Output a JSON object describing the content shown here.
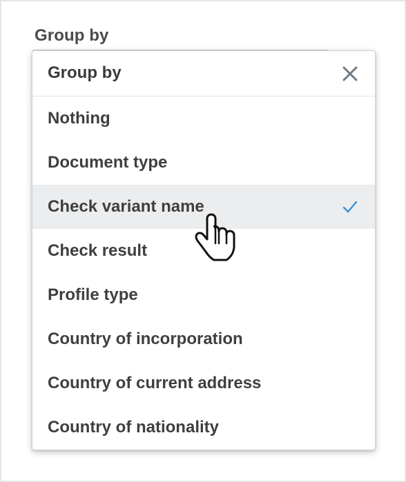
{
  "field": {
    "label": "Group by"
  },
  "dropdown": {
    "title": "Group by",
    "close_icon": "close-icon",
    "selected_index": 2,
    "options": [
      {
        "label": "Nothing"
      },
      {
        "label": "Document type"
      },
      {
        "label": "Check variant name"
      },
      {
        "label": "Check result"
      },
      {
        "label": "Profile type"
      },
      {
        "label": "Country of incorporation"
      },
      {
        "label": "Country of current address"
      },
      {
        "label": "Country of nationality"
      }
    ]
  },
  "colors": {
    "accent_check": "#3a8fd6",
    "selected_row_bg": "#ebedef",
    "text": "#3f3f3f"
  },
  "icons": {
    "close": "close-icon",
    "check": "checkmark-icon",
    "cursor": "hand-pointer-cursor-icon"
  }
}
